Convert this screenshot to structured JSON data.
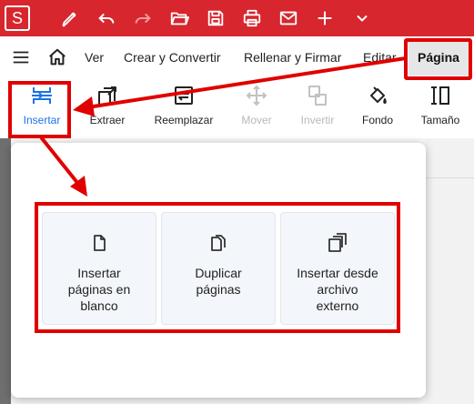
{
  "app": {
    "logo_letter": "S",
    "accent_color": "#d7262e"
  },
  "titlebar": {
    "icons": [
      "logo-icon",
      "pen-icon",
      "undo-icon",
      "redo-icon",
      "open-folder-icon",
      "save-icon",
      "print-icon",
      "email-icon",
      "add-icon",
      "chevron-down-icon"
    ]
  },
  "menubar": {
    "items": [
      {
        "label": "Ver"
      },
      {
        "label": "Crear y Convertir"
      },
      {
        "label": "Rellenar y Firmar"
      },
      {
        "label": "Editar"
      },
      {
        "label": "Página"
      }
    ],
    "active": "Página"
  },
  "ribbon": {
    "tools": [
      {
        "label": "Insertar",
        "state": "active"
      },
      {
        "label": "Extraer",
        "state": "enabled"
      },
      {
        "label": "Reemplazar",
        "state": "enabled"
      },
      {
        "label": "Mover",
        "state": "disabled"
      },
      {
        "label": "Invertir",
        "state": "disabled"
      },
      {
        "label": "Fondo",
        "state": "enabled"
      },
      {
        "label": "Tamaño",
        "state": "enabled"
      }
    ]
  },
  "insert_menu": {
    "options": [
      {
        "label_line1": "Insertar",
        "label_line2": "páginas en",
        "label_line3": "blanco"
      },
      {
        "label_line1": "Duplicar",
        "label_line2": "páginas",
        "label_line3": ""
      },
      {
        "label_line1": "Insertar desde",
        "label_line2": "archivo",
        "label_line3": "externo"
      }
    ]
  },
  "annotations": {
    "highlight_color": "#e00000"
  }
}
